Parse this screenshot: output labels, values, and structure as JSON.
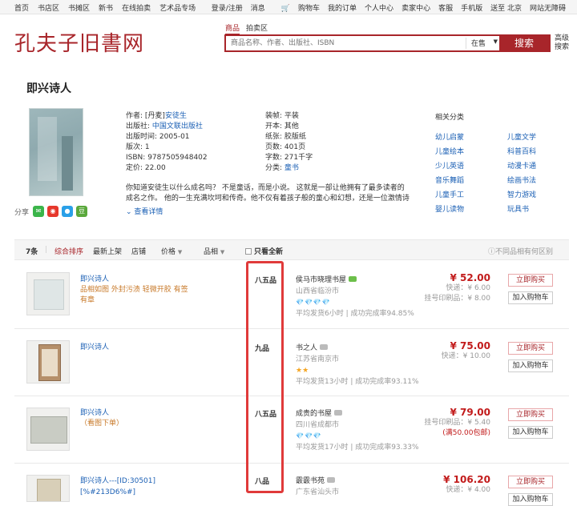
{
  "topnav": {
    "left": [
      "首页",
      "书店区",
      "书摊区",
      "新书",
      "在线拍卖",
      "艺术品专场"
    ],
    "right": [
      "登录/注册",
      "消息",
      "购物车",
      "我的订单",
      "个人中心",
      "卖家中心",
      "客服",
      "手机版",
      "送至 北京",
      "网站无障碍"
    ]
  },
  "logo": "孔夫子旧書网",
  "search": {
    "tabs": [
      "商品",
      "拍卖区"
    ],
    "placeholder": "商品名称、作者、出版社、ISBN",
    "scope": "在售",
    "button": "搜索",
    "advanced": "高级搜索"
  },
  "book": {
    "title": "即兴诗人",
    "col1": [
      {
        "label": "作者:",
        "pre": "[丹麦]",
        "link": "安徒生"
      },
      {
        "label": "出版社:",
        "link": "中国文联出版社"
      },
      {
        "label": "出版时间:",
        "value": "2005-01"
      },
      {
        "label": "版次:",
        "value": "1"
      },
      {
        "label": "ISBN:",
        "value": "9787505948402"
      },
      {
        "label": "定价:",
        "value": "22.00"
      }
    ],
    "col2": [
      {
        "label": "装帧:",
        "value": "平装"
      },
      {
        "label": "开本:",
        "value": "其他"
      },
      {
        "label": "纸张:",
        "value": "胶版纸"
      },
      {
        "label": "页数:",
        "value": "401页"
      },
      {
        "label": "字数:",
        "value": "271千字"
      },
      {
        "label": "分类:",
        "link": "童书"
      }
    ],
    "desc": [
      "你知道安徒生以什么成名吗？      不是童话，而是小说。      这就是一部让他拥有了最多读者的",
      "成名之作。      他的一生充满坎坷和传奇。他不仅有着孩子般的童心和幻想，还是一位激情诗"
    ],
    "more": "查看详情",
    "share_label": "分享"
  },
  "related": {
    "title": "相关分类",
    "items": [
      "幼儿启蒙",
      "儿童文学",
      "儿童绘本",
      "科普百科",
      "少儿英语",
      "动漫卡通",
      "音乐舞蹈",
      "绘画书法",
      "儿童手工",
      "智力游戏",
      "婴儿读物",
      "玩具书"
    ]
  },
  "filter": {
    "count": "7条",
    "sort": "综合排序",
    "newest": "最新上架",
    "shop": "店铺",
    "price": "价格",
    "grade": "品相",
    "only_new": "只看全新",
    "right": "不同品相有何区别"
  },
  "listings": [
    {
      "title": "即兴诗人",
      "note": [
        "品相如图 外封污渍 轻微开胶 有签",
        "有章"
      ],
      "condition": "八五品",
      "shop": "侯马市晓理书屋",
      "loc": "山西省临汾市",
      "rating": "💎💎💎💎",
      "stat": "平均发货6小时 | 成功完成率94.85%",
      "price": "¥ 52.00",
      "fee1": "快递：¥ 6.00",
      "fee2": "挂号印刷品：¥ 8.00",
      "btn1": "立即购买",
      "btn2": "加入购物车"
    },
    {
      "title": "即兴诗人",
      "note": [],
      "condition": "九品",
      "shop": "书之人",
      "loc": "江苏省南京市",
      "rating": "★★",
      "stat": "平均发货13小时 | 成功完成率93.11%",
      "price": "¥ 75.00",
      "fee1": "快递：¥ 10.00",
      "fee2": "",
      "btn1": "立即购买",
      "btn2": "加入购物车"
    },
    {
      "title": "即兴诗人",
      "note": [
        "（看图下单）"
      ],
      "condition": "八五品",
      "shop": "成贵的书屋",
      "loc": "四川省成都市",
      "rating": "💎💎💎",
      "stat": "平均发货17小时 | 成功完成率93.33%",
      "price": "¥ 79.00",
      "fee1": "挂号印刷品：¥ 5.40",
      "fee2": "(满50.00包邮)",
      "btn1": "立即购买",
      "btn2": "加入购物车"
    },
    {
      "title": "即兴诗人---[ID:30501]",
      "note": [
        "[%#213D6%#]"
      ],
      "condition": "八品",
      "shop": "霰霰书苑",
      "loc": "广东省汕头市",
      "rating": "",
      "stat": "",
      "price": "¥ 106.20",
      "fee1": "快递：¥ 4.00",
      "fee2": "",
      "btn1": "立即购买",
      "btn2": "加入购物车"
    }
  ]
}
